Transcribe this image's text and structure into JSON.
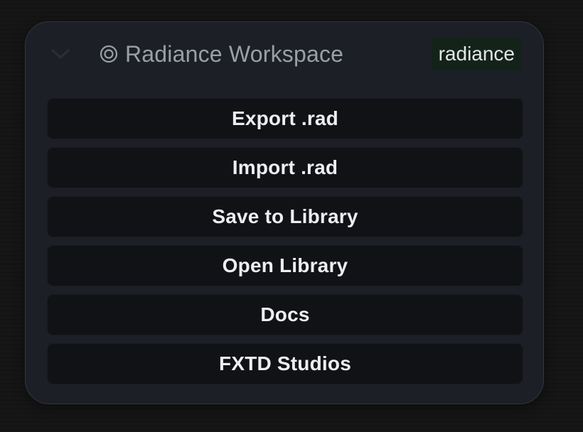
{
  "panel": {
    "title": "Radiance Workspace",
    "title_icon": "target-icon",
    "collapse_icon": "chevron-down-icon",
    "badge": "radiance",
    "colors": {
      "panel_background": "#1c1f26",
      "button_background": "#101216",
      "badge_background": "#14231a",
      "title_text": "#9a9fa8",
      "button_text": "#eceef1"
    }
  },
  "actions": [
    {
      "label": "Export .rad"
    },
    {
      "label": "Import .rad"
    },
    {
      "label": "Save to Library"
    },
    {
      "label": "Open Library"
    },
    {
      "label": "Docs"
    },
    {
      "label": "FXTD Studios"
    }
  ]
}
